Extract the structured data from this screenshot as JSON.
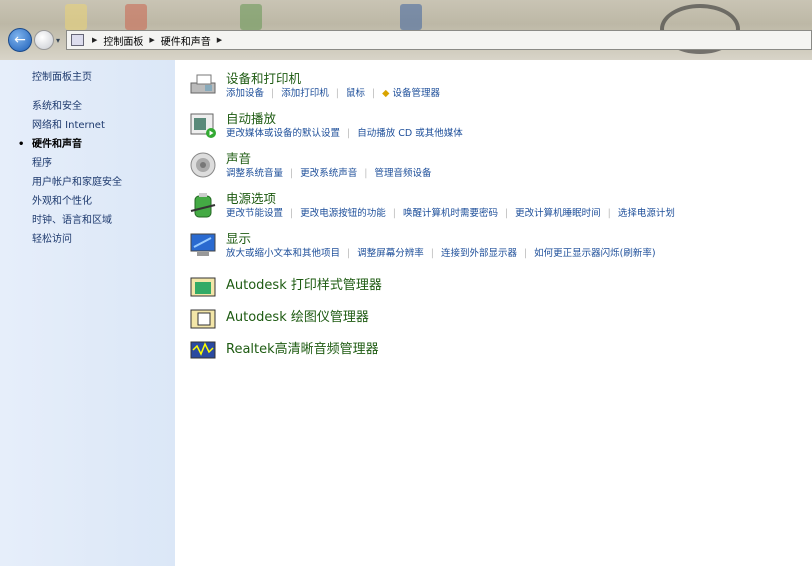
{
  "address": {
    "crumbs": [
      "控制面板",
      "硬件和声音"
    ]
  },
  "left_nav": {
    "home": "控制面板主页",
    "items": [
      "系统和安全",
      "网络和 Internet",
      "硬件和声音",
      "程序",
      "用户帐户和家庭安全",
      "外观和个性化",
      "时钟、语言和区域",
      "轻松访问"
    ],
    "current": "硬件和声音"
  },
  "categories": [
    {
      "title": "设备和打印机",
      "links": [
        "添加设备",
        "添加打印机",
        "鼠标",
        "设备管理器"
      ]
    },
    {
      "title": "自动播放",
      "links": [
        "更改媒体或设备的默认设置",
        "自动播放 CD 或其他媒体"
      ]
    },
    {
      "title": "声音",
      "links": [
        "调整系统音量",
        "更改系统声音",
        "管理音频设备"
      ]
    },
    {
      "title": "电源选项",
      "links": [
        "更改节能设置",
        "更改电源按钮的功能",
        "唤醒计算机时需要密码",
        "更改计算机睡眠时间",
        "选择电源计划"
      ]
    },
    {
      "title": "显示",
      "links": [
        "放大或缩小文本和其他项目",
        "调整屏幕分辨率",
        "连接到外部显示器",
        "如何更正显示器闪烁(刷新率)"
      ]
    }
  ],
  "extras": [
    "Autodesk 打印样式管理器",
    "Autodesk 绘图仪管理器",
    "Realtek高清晰音频管理器"
  ]
}
